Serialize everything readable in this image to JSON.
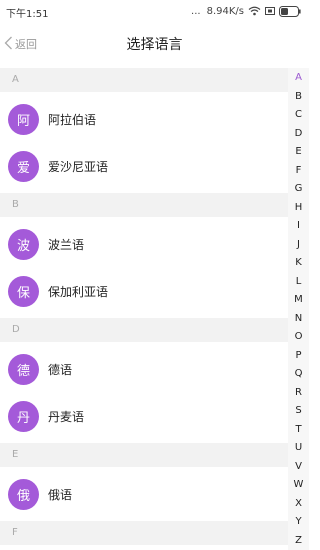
{
  "status_bar": {
    "time": "下午1:51",
    "dots": "...",
    "speed": "8.94K/s"
  },
  "nav": {
    "back_label": "返回",
    "title": "选择语言"
  },
  "sections": [
    {
      "header": "A",
      "items": [
        {
          "avatar": "阿",
          "name": "阿拉伯语"
        },
        {
          "avatar": "爱",
          "name": "爱沙尼亚语"
        }
      ]
    },
    {
      "header": "B",
      "items": [
        {
          "avatar": "波",
          "name": "波兰语"
        },
        {
          "avatar": "保",
          "name": "保加利亚语"
        }
      ]
    },
    {
      "header": "D",
      "items": [
        {
          "avatar": "德",
          "name": "德语"
        },
        {
          "avatar": "丹",
          "name": "丹麦语"
        }
      ]
    },
    {
      "header": "E",
      "items": [
        {
          "avatar": "俄",
          "name": "俄语"
        }
      ]
    },
    {
      "header": "F",
      "items": []
    }
  ],
  "index_letters": [
    "A",
    "B",
    "C",
    "D",
    "E",
    "F",
    "G",
    "H",
    "I",
    "J",
    "K",
    "L",
    "M",
    "N",
    "O",
    "P",
    "Q",
    "R",
    "S",
    "T",
    "U",
    "V",
    "W",
    "X",
    "Y",
    "Z"
  ],
  "index_active": "A",
  "colors": {
    "accent": "#a45ad9",
    "index_active": "#9b59d0",
    "section_bg": "#f2f2f2"
  }
}
